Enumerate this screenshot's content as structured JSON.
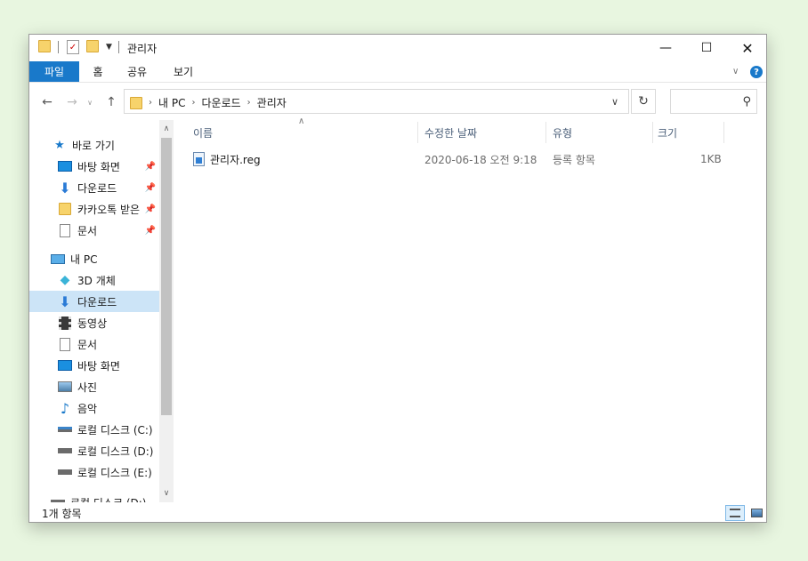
{
  "window": {
    "title": "관리자"
  },
  "ribbon": {
    "tabs": [
      "파일",
      "홈",
      "공유",
      "보기"
    ]
  },
  "address": {
    "crumbs": [
      "내 PC",
      "다운로드",
      "관리자"
    ],
    "search_placeholder": ""
  },
  "nav": {
    "quick_access": "바로 가기",
    "quick_items": [
      "바탕 화면",
      "다운로드",
      "카카오톡 받은",
      "문서"
    ],
    "this_pc": "내 PC",
    "pc_items": [
      "3D 개체",
      "다운로드",
      "동영상",
      "문서",
      "바탕 화면",
      "사진",
      "음악",
      "로컬 디스크 (C:)",
      "로컬 디스크 (D:)",
      "로컬 디스크 (E:)"
    ],
    "cut_item": "로컬 디스크 (D:)",
    "selected": "다운로드"
  },
  "columns": {
    "name": "이름",
    "modified": "수정한 날짜",
    "type": "유형",
    "size": "크기"
  },
  "files": [
    {
      "name": "관리자.reg",
      "modified": "2020-06-18 오전 9:18",
      "type": "등록 항목",
      "size": "1KB"
    }
  ],
  "status": {
    "count_text": "1개 항목"
  },
  "colors": {
    "accent": "#1979ca",
    "selected_bg": "#cce4f7",
    "folder": "#f7d36b"
  }
}
